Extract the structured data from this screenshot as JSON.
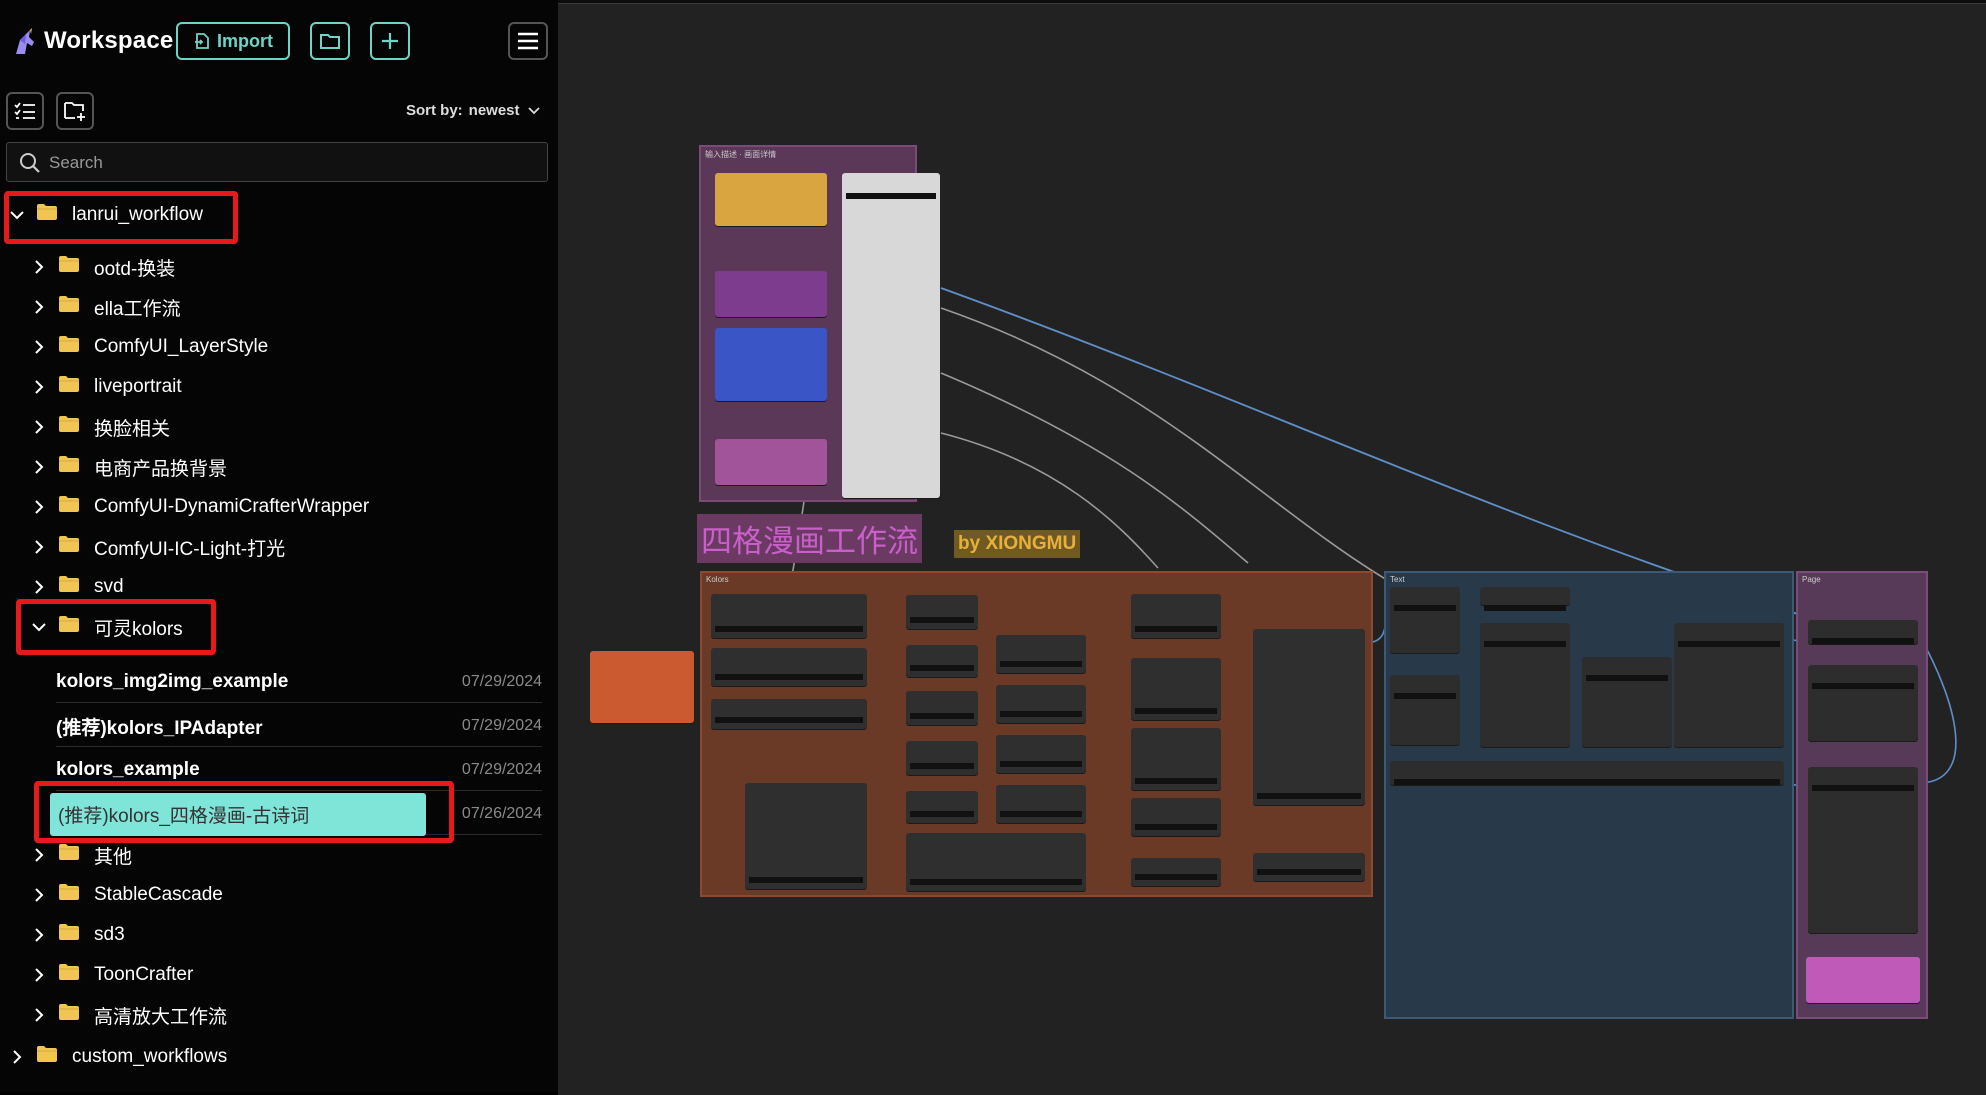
{
  "header": {
    "title": "Workspace",
    "import_label": "Import"
  },
  "toolbar": {
    "sort_label": "Sort by:",
    "sort_value": "newest"
  },
  "search": {
    "placeholder": "Search"
  },
  "tree": {
    "root_folder": "lanrui_workflow",
    "subfolders_top": [
      "ootd-换装",
      "ella工作流",
      "ComfyUI_LayerStyle",
      "liveportrait",
      "换脸相关",
      "电商产品换背景",
      "ComfyUI-DynamiCrafterWrapper",
      "ComfyUI-IC-Light-打光",
      "svd"
    ],
    "open_folder": "可灵kolors",
    "files": [
      {
        "name": "kolors_img2img_example",
        "date": "07/29/2024"
      },
      {
        "name": "(推荐)kolors_IPAdapter",
        "date": "07/29/2024"
      },
      {
        "name": "kolors_example",
        "date": "07/29/2024"
      },
      {
        "name": "(推荐)kolors_四格漫画-古诗词",
        "date": "07/26/2024"
      }
    ],
    "subfolders_bottom": [
      "其他",
      "StableCascade",
      "sd3",
      "ToonCrafter",
      "高清放大工作流"
    ],
    "other_root": "custom_workflows"
  },
  "canvas": {
    "workflow_title": "四格漫画工作流",
    "author_tag": "by XIONGMU",
    "group_labels": [
      "输入描述 · 画面详情",
      "Kolors",
      "Text",
      "Page"
    ]
  },
  "colors": {
    "accent": "#6fd3c6",
    "selected_bg": "#7fe5d9",
    "highlight": "#e8191c",
    "folder": "#f0c552"
  }
}
